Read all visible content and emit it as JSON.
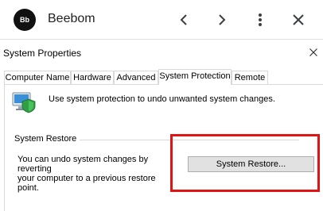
{
  "topbar": {
    "avatar_text": "Bb",
    "app_name": "Beebom"
  },
  "dialog": {
    "title": "System Properties",
    "tabs": [
      {
        "label": "Computer Name"
      },
      {
        "label": "Hardware"
      },
      {
        "label": "Advanced"
      },
      {
        "label": "System Protection",
        "active": true
      },
      {
        "label": "Remote"
      }
    ],
    "intro_text": "Use system protection to undo unwanted system changes.",
    "system_restore": {
      "group_label": "System Restore",
      "description_line1": "You can undo system changes by reverting",
      "description_line2": "your computer to a previous restore point.",
      "button_label": "System Restore..."
    }
  },
  "colors": {
    "highlight": "#e01414",
    "button_bg": "#e1e1e1",
    "avatar_bg": "#111111"
  },
  "icons": [
    "back-icon",
    "forward-icon",
    "more-vert-icon",
    "close-icon",
    "dialog-close-icon",
    "system-protection-icon"
  ]
}
